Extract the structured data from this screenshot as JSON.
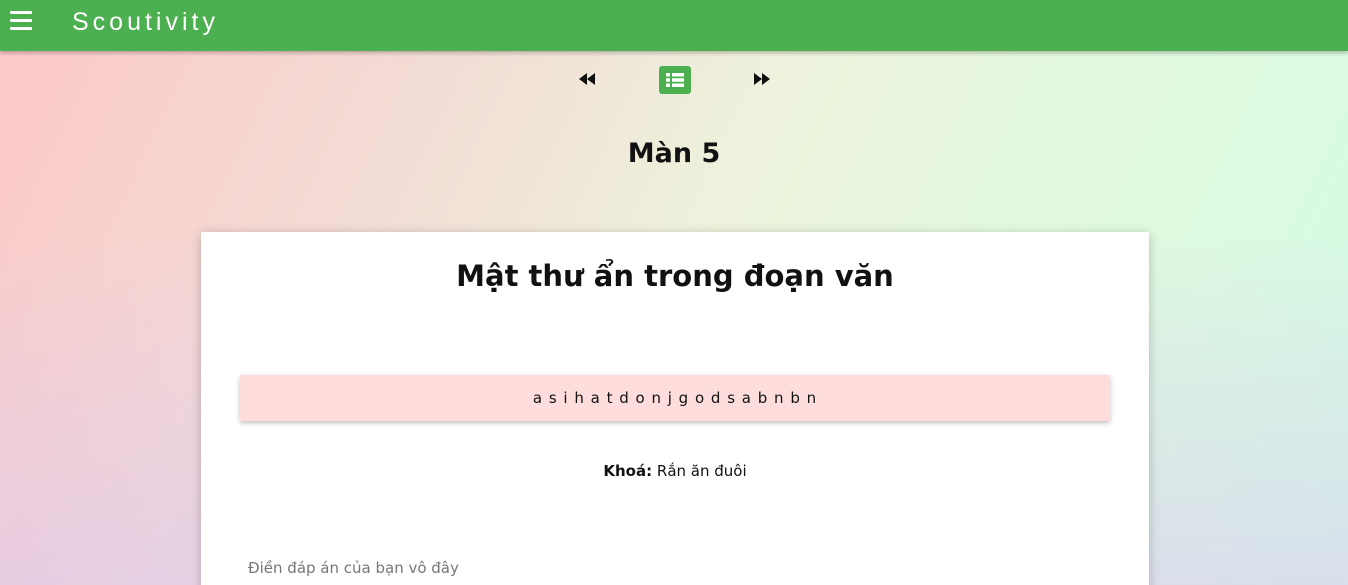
{
  "app": {
    "brand": "Scoutivity",
    "accent_color": "#4caf50"
  },
  "nav": {
    "prev_icon": "rewind-icon",
    "list_icon": "list-icon",
    "next_icon": "fast-forward-icon"
  },
  "level": {
    "title": "Màn 5"
  },
  "card": {
    "title": "Mật thư ẩn trong đoạn văn",
    "cipher_text": "a s i h a t d o n j g o d s a b n b n",
    "key_label": "Khoá:",
    "key_value": "Rắn ăn đuôi",
    "answer_placeholder": "Điền đáp án của bạn vô đây",
    "answer_value": ""
  }
}
